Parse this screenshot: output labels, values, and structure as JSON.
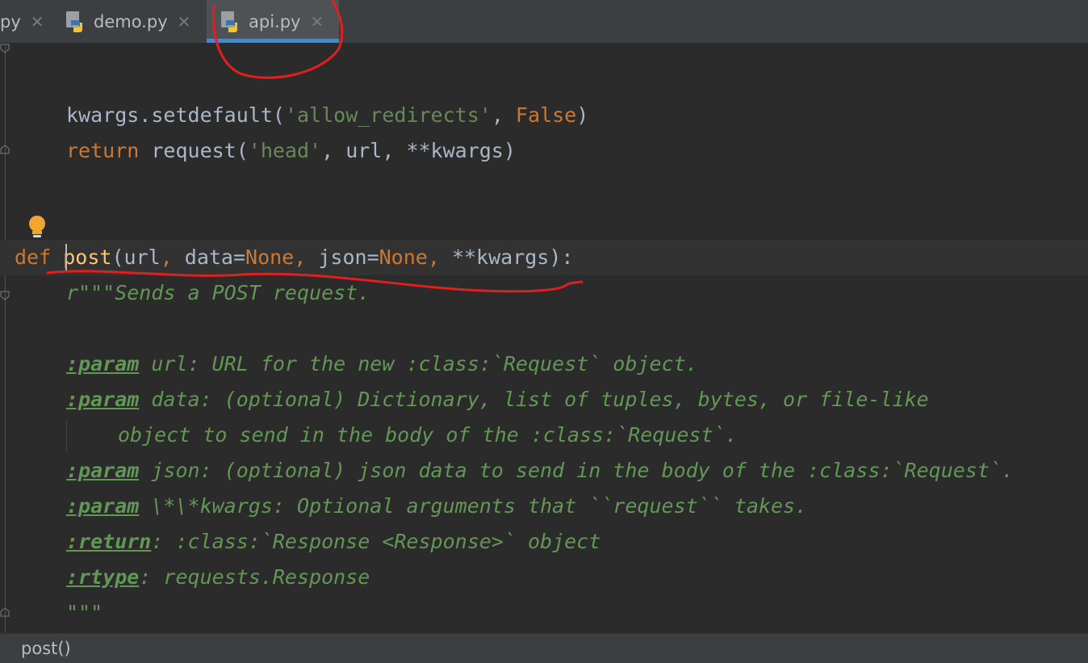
{
  "tabs": [
    {
      "label": "py",
      "close": "✕",
      "active": false
    },
    {
      "label": "demo.py",
      "close": "✕",
      "active": false
    },
    {
      "label": "api.py",
      "close": "✕",
      "active": true
    }
  ],
  "code": {
    "l1": {
      "a": "kwargs.setdefault(",
      "b": "'allow_redirects'",
      "c": ", ",
      "d": "False",
      "e": ")"
    },
    "l2": {
      "a": "return ",
      "b": "request(",
      "c": "'head'",
      "d": ", url, ",
      "e": "**kwargs)"
    },
    "l3": {
      "a": "def ",
      "b": "post",
      "c": "(url",
      "d": ", ",
      "e": "data=",
      "f": "None",
      "g": ", ",
      "h": "json=",
      "i": "None",
      "j": ", ",
      "k": "**kwargs):"
    },
    "l4": {
      "a": "r\"\"\"Sends a POST request."
    },
    "l5": {
      "tag": ":param",
      "rest": " url: URL for the new :class:`Request` object."
    },
    "l6": {
      "tag": ":param",
      "rest": " data: (optional) Dictionary, list of tuples, bytes, or file-like"
    },
    "l7": {
      "rest": "object to send in the body of the :class:`Request`."
    },
    "l8": {
      "tag": ":param",
      "rest": " json: (optional) json data to send in the body of the :class:`Request`."
    },
    "l9": {
      "tag": ":param",
      "rest": " \\*\\*kwargs: Optional arguments that ``request`` takes."
    },
    "l10": {
      "tag": ":return",
      "rest": ": :class:`Response <Response>` object"
    },
    "l11": {
      "tag": ":rtype",
      "rest": ": requests.Response"
    },
    "l12": {
      "rest": "\"\"\""
    }
  },
  "status": {
    "breadcrumb": "post()"
  },
  "colors": {
    "annotation": "#e0201e",
    "tab_underline": "#4a88c7",
    "bulb": "#f0a732"
  }
}
